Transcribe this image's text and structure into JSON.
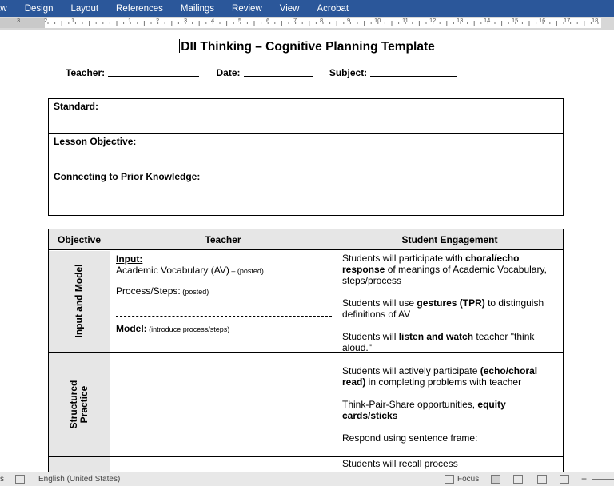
{
  "ribbon": {
    "tabs": [
      "aw",
      "Design",
      "Layout",
      "References",
      "Mailings",
      "Review",
      "View",
      "Acrobat"
    ]
  },
  "ruler": {
    "numbers": [
      "3",
      "2",
      "1",
      "1",
      "2",
      "3",
      "4",
      "5",
      "6",
      "7",
      "8",
      "9",
      "10",
      "11",
      "12",
      "13",
      "14",
      "15",
      "16",
      "17",
      "18"
    ]
  },
  "document": {
    "title": "DII Thinking – Cognitive Planning Template",
    "teacher_label": "Teacher:",
    "date_label": "Date:",
    "subject_label": "Subject:",
    "standard_label": "Standard:",
    "lesson_objective_label": "Lesson Objective:",
    "prior_knowledge_label": "Connecting to Prior Knowledge:"
  },
  "table": {
    "headers": {
      "objective": "Objective",
      "teacher": "Teacher",
      "student": "Student Engagement"
    },
    "rows": {
      "input_model": {
        "label": "Input and Model",
        "input_heading": "Input:",
        "vocab_text": "Academic Vocabulary (AV)",
        "vocab_note": " – (posted)",
        "process_text": "Process/Steps:",
        "process_note": " (posted)",
        "model_heading": "Model:",
        "model_note": " (introduce process/steps)",
        "s1_pre": "Students will participate with ",
        "s1_bold": "choral/echo response",
        "s1_post": " of meanings of Academic Vocabulary, steps/process",
        "s2_pre": "Students will use ",
        "s2_bold": "gestures (TPR)",
        "s2_post": " to distinguish definitions of AV",
        "s3_pre": "Students will ",
        "s3_bold": "listen and watch",
        "s3_post": " teacher \"think aloud.\""
      },
      "structured": {
        "label_line1": "Structured",
        "label_line2": "Practice",
        "s1_pre": "Students will actively participate ",
        "s1_bold": "(echo/choral read)",
        "s1_post": " in completing problems with teacher",
        "s2_pre": "Think-Pair-Share opportunities, ",
        "s2_bold": "equity cards/sticks",
        "s3": "Respond using sentence frame:"
      },
      "next": {
        "s1": "Students will recall process"
      }
    }
  },
  "status_bar": {
    "page_fragment": "s",
    "language": "English (United States)",
    "focus": "Focus"
  }
}
